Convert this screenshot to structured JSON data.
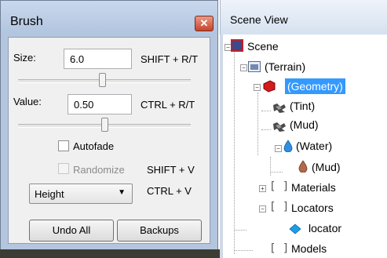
{
  "brush": {
    "title": "Brush",
    "close_label": "✕",
    "size_label": "Size:",
    "size_value": "6.0",
    "size_hotkey": "SHIFT + R/T",
    "size_slider_fraction": 0.49,
    "value_label": "Value:",
    "value_value": "0.50",
    "value_hotkey": "CTRL + R/T",
    "value_slider_fraction": 0.5,
    "autofade_label": "Autofade",
    "autofade_checked": false,
    "randomize_label": "Randomize",
    "randomize_checked": false,
    "randomize_hotkey": "SHIFT + V",
    "mode_selected": "Height",
    "mode_hotkey": "CTRL + V",
    "undo_all_label": "Undo All",
    "backups_label": "Backups"
  },
  "scene": {
    "title": "Scene View",
    "nodes": {
      "scene": "Scene",
      "terrain": "(Terrain)",
      "geometry": "(Geometry)",
      "tint": "(Tint)",
      "mud1": "(Mud)",
      "water": "(Water)",
      "mud2": "(Mud)",
      "materials": "Materials",
      "locators": "Locators",
      "locator": "locator",
      "models": "Models"
    }
  },
  "colors": {
    "selection": "#3399ff",
    "window_frame": "#b4c6de"
  }
}
